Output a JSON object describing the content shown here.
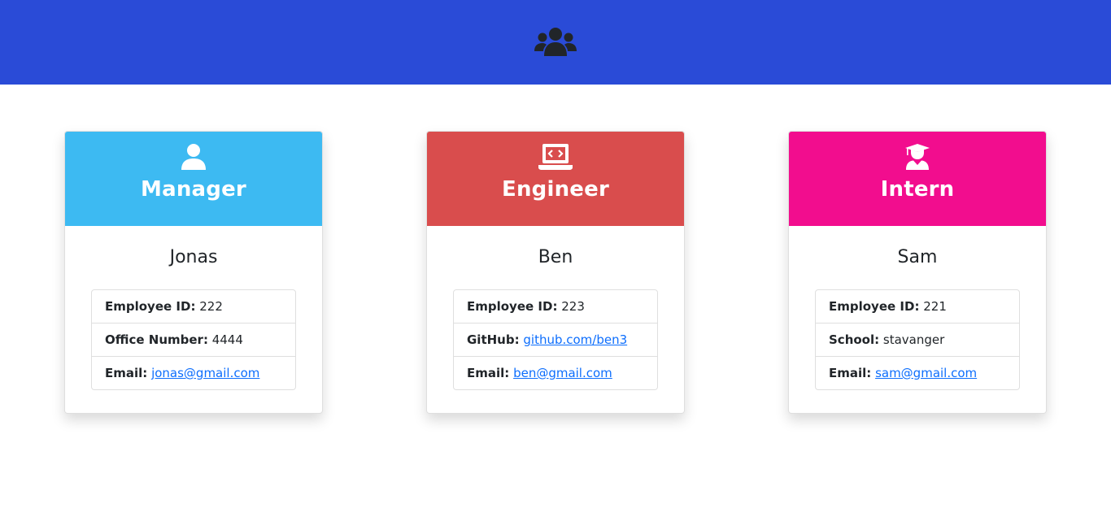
{
  "header": {
    "icon": "users-icon",
    "color": "#2a4bd7"
  },
  "cards": [
    {
      "role": "Manager",
      "icon": "user-icon",
      "color": "#3dbaf2",
      "name": "Jonas",
      "rows": [
        {
          "label": "Employee ID:",
          "value": "222",
          "link": false
        },
        {
          "label": "Office Number:",
          "value": "4444",
          "link": false
        },
        {
          "label": "Email:",
          "value": "jonas@gmail.com",
          "link": true
        }
      ]
    },
    {
      "role": "Engineer",
      "icon": "laptop-code-icon",
      "color": "#d94d4d",
      "name": "Ben",
      "rows": [
        {
          "label": "Employee ID:",
          "value": "223",
          "link": false
        },
        {
          "label": "GitHub:",
          "value": "github.com/ben3",
          "link": true
        },
        {
          "label": "Email:",
          "value": "ben@gmail.com",
          "link": true
        }
      ]
    },
    {
      "role": "Intern",
      "icon": "user-graduate-icon",
      "color": "#f20d8e",
      "name": "Sam",
      "rows": [
        {
          "label": "Employee ID:",
          "value": "221",
          "link": false
        },
        {
          "label": "School:",
          "value": "stavanger",
          "link": false
        },
        {
          "label": "Email:",
          "value": "sam@gmail.com",
          "link": true
        }
      ]
    }
  ]
}
